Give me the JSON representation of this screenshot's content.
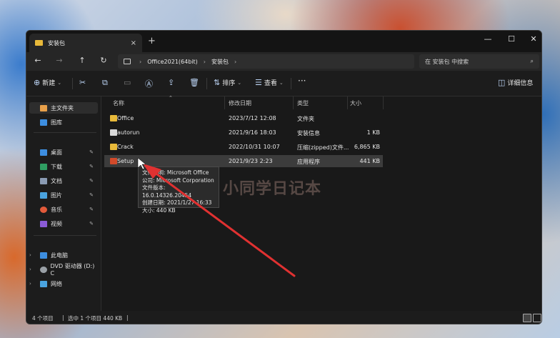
{
  "window": {
    "tab_title": "安装包",
    "new_tab": "+",
    "minimize": "—",
    "maximize": "☐",
    "close": "✕"
  },
  "nav": {
    "back": "←",
    "forward": "→",
    "up": "↑",
    "refresh": "↻",
    "breadcrumb": [
      "Office2021(64bit)",
      "安装包"
    ],
    "search_placeholder": "在 安装包 中搜索"
  },
  "toolbar": {
    "new_label": "新建",
    "sort_label": "排序",
    "view_label": "查看",
    "more": "···",
    "details_label": "详细信息"
  },
  "sidebar": {
    "home": "主文件夹",
    "gallery": "图库",
    "pinned": [
      "桌面",
      "下载",
      "文档",
      "图片",
      "音乐",
      "视频"
    ],
    "this_pc": "此电脑",
    "dvd": "DVD 驱动器 (D:) C",
    "network": "网络"
  },
  "columns": {
    "name": "名称",
    "date": "修改日期",
    "type": "类型",
    "size": "大小"
  },
  "files": [
    {
      "name": "Office",
      "date": "2023/7/12 12:08",
      "type": "文件夹",
      "size": ""
    },
    {
      "name": "autorun",
      "date": "2021/9/16 18:03",
      "type": "安装信息",
      "size": "1 KB"
    },
    {
      "name": "Crack",
      "date": "2022/10/31 10:07",
      "type": "压缩(zipped)文件...",
      "size": "6,865 KB"
    },
    {
      "name": "Setup",
      "date": "2021/9/23 2:23",
      "type": "应用程序",
      "size": "441 KB"
    }
  ],
  "tooltip": {
    "lines": [
      "文件说明: Microsoft Office",
      "公司: Microsoft Corporation",
      "文件版本: 16.0.14326.20454",
      "创建日期: 2021/1/27 16:33",
      "大小: 440 KB"
    ]
  },
  "status": {
    "count": "4 个项目",
    "selected": "选中 1 个项目  440 KB"
  },
  "watermark": "小同学日记本",
  "colors": {
    "folder": "#e8b93a",
    "accent": "#bcd4f5",
    "arrow": "#e03131"
  }
}
